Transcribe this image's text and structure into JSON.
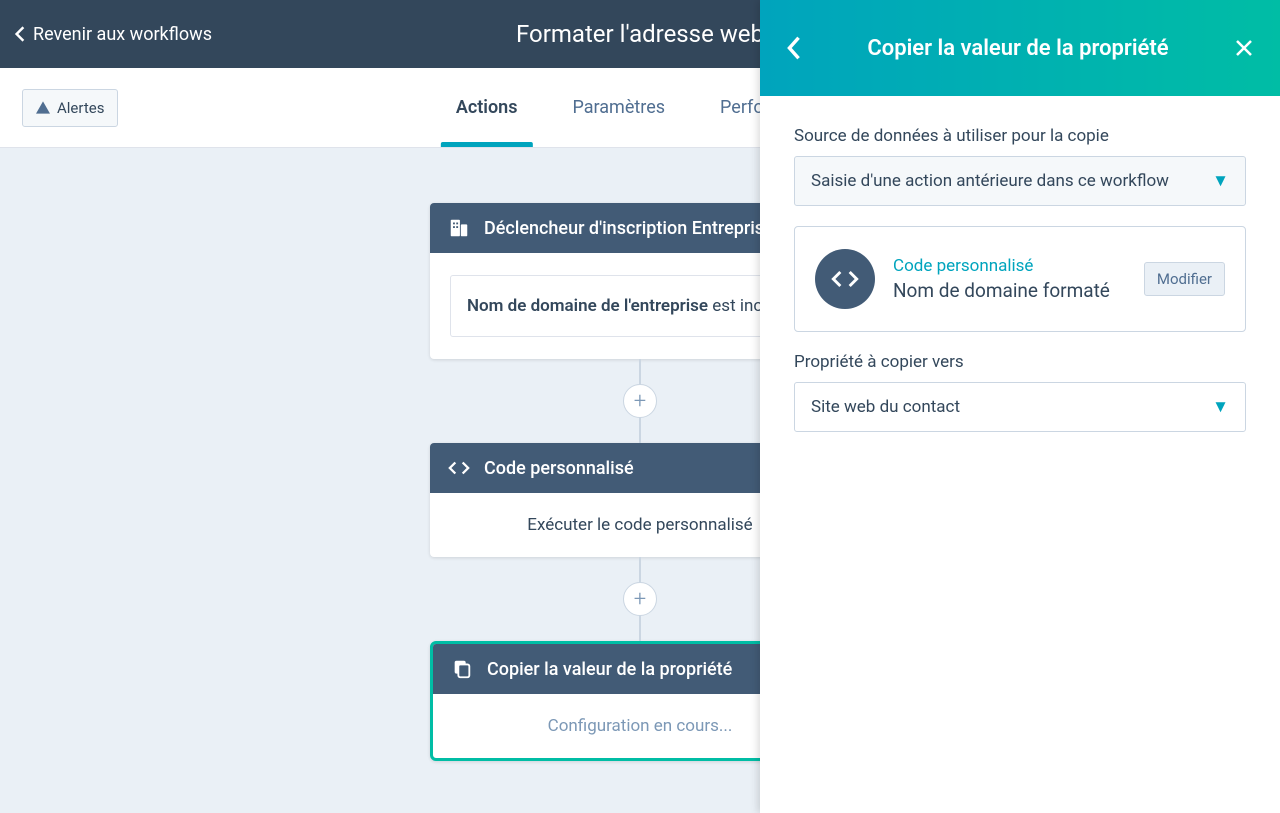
{
  "header": {
    "back_label": "Revenir aux workflows",
    "title": "Formater l'adresse web"
  },
  "subheader": {
    "alerts_label": "Alertes",
    "tabs": [
      "Actions",
      "Paramètres",
      "Performance"
    ]
  },
  "workflow": {
    "trigger": {
      "title": "Déclencheur d'inscription Entreprise",
      "condition_strong": "Nom de domaine de l'entreprise",
      "condition_rest": " est inconnu"
    },
    "code": {
      "title": "Code personnalisé",
      "body": "Exécuter le code personnalisé"
    },
    "copy": {
      "title": "Copier la valeur de la propriété",
      "body": "Configuration en cours..."
    }
  },
  "panel": {
    "title": "Copier la valeur de la propriété",
    "source_label": "Source de données à utiliser pour la copie",
    "source_value": "Saisie d'une action antérieure dans ce workflow",
    "source_card": {
      "link": "Code personnalisé",
      "sub": "Nom de domaine formaté",
      "modify": "Modifier"
    },
    "target_label": "Propriété à copier vers",
    "target_value": "Site web du contact"
  }
}
